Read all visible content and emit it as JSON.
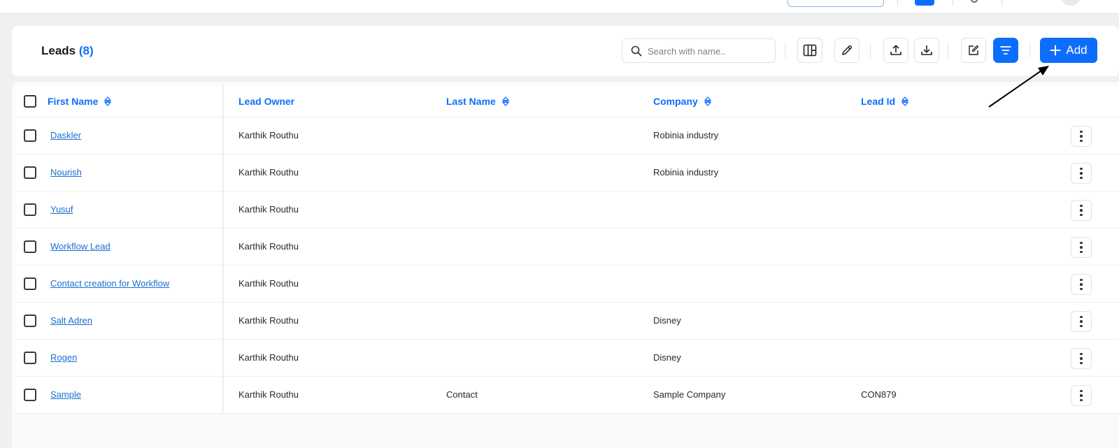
{
  "header": {
    "title": "Leads",
    "count": "(8)",
    "search_placeholder": "Search with name..",
    "add_label": "Add"
  },
  "colors": {
    "accent": "#0d6efd",
    "link": "#1a6fd1"
  },
  "toolbar": {
    "icons": [
      "columns-icon",
      "pencil-icon",
      "upload-icon",
      "download-icon",
      "edit-square-icon",
      "filter-icon",
      "plus-icon"
    ]
  },
  "table": {
    "columns": [
      "First Name",
      "Lead Owner",
      "Last Name",
      "Company",
      "Lead Id"
    ],
    "rows": [
      {
        "first_name": "Daskler",
        "lead_owner": "Karthik Routhu",
        "last_name": "",
        "company": "Robinia industry",
        "lead_id": ""
      },
      {
        "first_name": "Nourish",
        "lead_owner": "Karthik Routhu",
        "last_name": "",
        "company": "Robinia industry",
        "lead_id": ""
      },
      {
        "first_name": "Yusuf",
        "lead_owner": "Karthik Routhu",
        "last_name": "",
        "company": "",
        "lead_id": ""
      },
      {
        "first_name": "Workflow Lead",
        "lead_owner": "Karthik Routhu",
        "last_name": "",
        "company": "",
        "lead_id": ""
      },
      {
        "first_name": "Contact creation for Workflow",
        "lead_owner": "Karthik Routhu",
        "last_name": "",
        "company": "",
        "lead_id": ""
      },
      {
        "first_name": "Salt Adren",
        "lead_owner": "Karthik Routhu",
        "last_name": "",
        "company": "Disney",
        "lead_id": ""
      },
      {
        "first_name": "Rogen",
        "lead_owner": "Karthik Routhu",
        "last_name": "",
        "company": "Disney",
        "lead_id": ""
      },
      {
        "first_name": "Sample",
        "lead_owner": "Karthik Routhu",
        "last_name": "Contact",
        "company": "Sample Company",
        "lead_id": "CON879"
      }
    ]
  }
}
